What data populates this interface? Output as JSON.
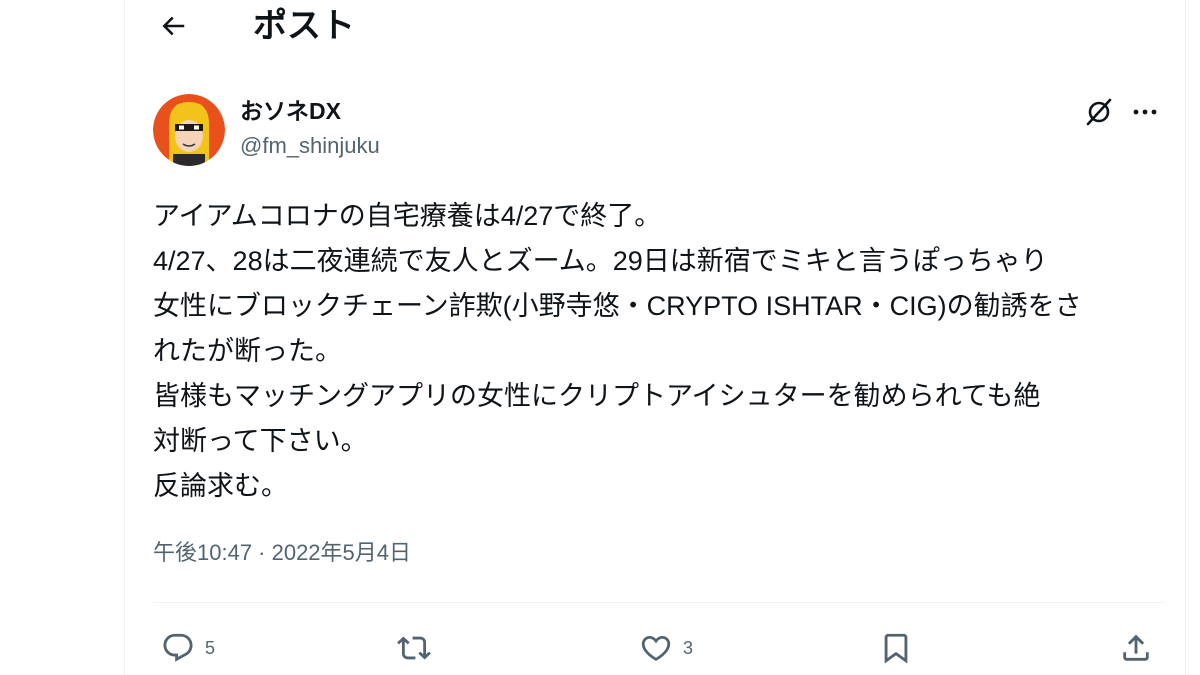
{
  "header": {
    "back_icon": "arrow-left-icon",
    "title": "ポスト"
  },
  "author": {
    "display_name": "おソネDX",
    "handle": "@fm_shinjuku",
    "avatar_icon": "yellow-hood-avatar"
  },
  "post": {
    "lines": [
      "アイアムコロナの自宅療養は4/27で終了。",
      "4/27、28は二夜連続で友人とズーム。29日は新宿でミキと言うぽっちゃり",
      "女性にブロックチェーン詐欺(小野寺悠・CRYPTO ISHTAR・CIG)の勧誘をさ",
      "れたが断った。",
      "皆様もマッチングアプリの女性にクリプトアイシュターを勧められても絶",
      "対断って下さい。",
      "反論求む。"
    ],
    "timestamp": "午後10:47 · 2022年5月4日"
  },
  "actions": {
    "reply_count": "5",
    "repost_count": "",
    "like_count": "3"
  },
  "colors": {
    "text": "#0f1419",
    "secondary": "#536471",
    "border": "#eff3f4"
  }
}
